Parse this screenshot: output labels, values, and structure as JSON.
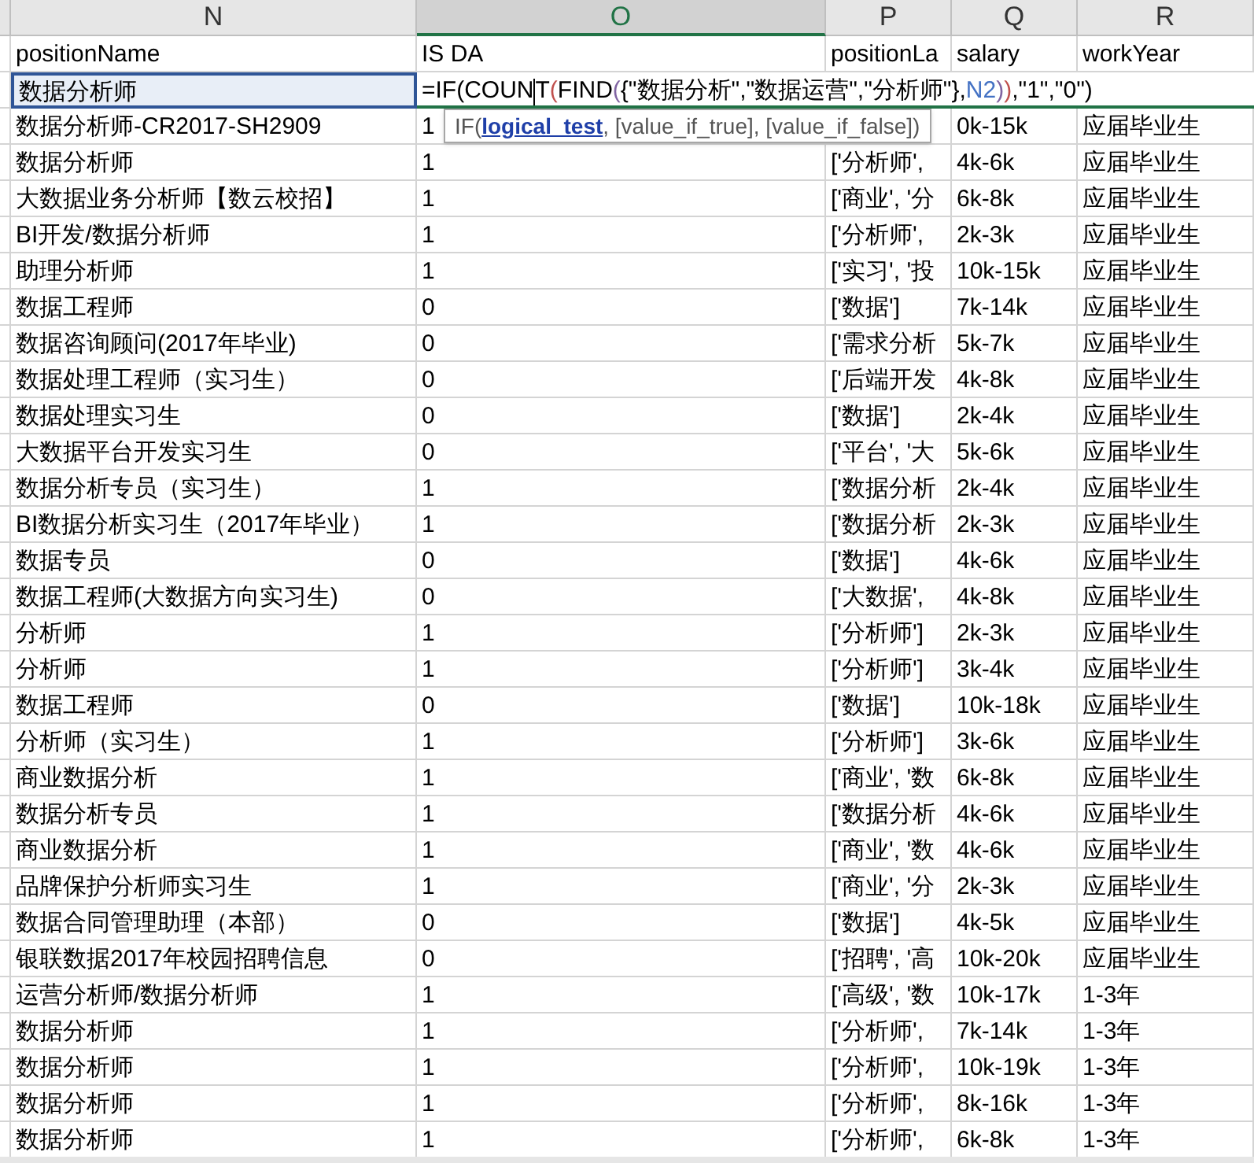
{
  "columns": [
    {
      "letter": "N",
      "selected": false
    },
    {
      "letter": "O",
      "selected": true
    },
    {
      "letter": "P",
      "selected": false
    },
    {
      "letter": "Q",
      "selected": false
    },
    {
      "letter": "R",
      "selected": false
    }
  ],
  "header_row": [
    "positionName",
    "IS DA",
    "positionLa",
    "salary",
    "workYear"
  ],
  "editing_row": {
    "name": "数据分析师",
    "selected": true,
    "formula": [
      {
        "text": "=IF(COUN",
        "color": "#000000"
      },
      {
        "text": "T",
        "color": "#000000"
      },
      {
        "text": "(",
        "color": "#c0504d"
      },
      {
        "text": "FIND",
        "color": "#000000"
      },
      {
        "text": "(",
        "color": "#8064a2"
      },
      {
        "text": "{\"数据分析\",\"数据运营\",\"分析师\"}",
        "color": "#000000"
      },
      {
        "text": ",",
        "color": "#000000"
      },
      {
        "text": "N2",
        "color": "#4472c4"
      },
      {
        "text": ")",
        "color": "#8064a2"
      },
      {
        "text": ")",
        "color": "#c0504d"
      },
      {
        "text": ",\"1\",\"0\")",
        "color": "#000000"
      }
    ]
  },
  "tooltip": {
    "prefix": "IF(",
    "argument": "logical_test",
    "suffix": ", [value_if_true], [value_if_false])"
  },
  "rows": [
    {
      "name": "数据分析师-CR2017-SH2909",
      "flag": "1",
      "salary": "0k-15k",
      "years": "应届毕业生"
    },
    {
      "name": "数据分析师",
      "flag": "1",
      "tags": "['分析师',",
      "salary": "4k-6k",
      "years": "应届毕业生"
    },
    {
      "name": "大数据业务分析师【数云校招】",
      "flag": "1",
      "tags": "['商业', '分",
      "salary": "6k-8k",
      "years": "应届毕业生"
    },
    {
      "name": "BI开发/数据分析师",
      "flag": "1",
      "tags": "['分析师',",
      "salary": "2k-3k",
      "years": "应届毕业生"
    },
    {
      "name": "助理分析师",
      "flag": "1",
      "tags": "['实习', '投",
      "salary": "10k-15k",
      "years": "应届毕业生"
    },
    {
      "name": "数据工程师",
      "flag": "0",
      "tags": "['数据']",
      "salary": "7k-14k",
      "years": "应届毕业生"
    },
    {
      "name": "数据咨询顾问(2017年毕业)",
      "flag": "0",
      "tags": "['需求分析",
      "salary": "5k-7k",
      "years": "应届毕业生"
    },
    {
      "name": "数据处理工程师（实习生）",
      "flag": "0",
      "tags": "['后端开发",
      "salary": "4k-8k",
      "years": "应届毕业生"
    },
    {
      "name": "数据处理实习生",
      "flag": "0",
      "tags": "['数据']",
      "salary": "2k-4k",
      "years": "应届毕业生"
    },
    {
      "name": "大数据平台开发实习生",
      "flag": "0",
      "tags": "['平台', '大",
      "salary": "5k-6k",
      "years": "应届毕业生"
    },
    {
      "name": "数据分析专员（实习生）",
      "flag": "1",
      "tags": "['数据分析",
      "salary": "2k-4k",
      "years": "应届毕业生"
    },
    {
      "name": "BI数据分析实习生（2017年毕业）",
      "flag": "1",
      "tags": "['数据分析",
      "salary": "2k-3k",
      "years": "应届毕业生"
    },
    {
      "name": "数据专员",
      "flag": "0",
      "tags": "['数据']",
      "salary": "4k-6k",
      "years": "应届毕业生"
    },
    {
      "name": "数据工程师(大数据方向实习生)",
      "flag": "0",
      "tags": "['大数据',",
      "salary": "4k-8k",
      "years": "应届毕业生"
    },
    {
      "name": "分析师",
      "flag": "1",
      "tags": "['分析师']",
      "salary": "2k-3k",
      "years": "应届毕业生"
    },
    {
      "name": "分析师",
      "flag": "1",
      "tags": "['分析师']",
      "salary": "3k-4k",
      "years": "应届毕业生"
    },
    {
      "name": "数据工程师",
      "flag": "0",
      "tags": "['数据']",
      "salary": "10k-18k",
      "years": "应届毕业生"
    },
    {
      "name": "分析师（实习生）",
      "flag": "1",
      "tags": "['分析师']",
      "salary": "3k-6k",
      "years": "应届毕业生"
    },
    {
      "name": "商业数据分析",
      "flag": "1",
      "tags": "['商业', '数",
      "salary": "6k-8k",
      "years": "应届毕业生"
    },
    {
      "name": "数据分析专员",
      "flag": "1",
      "tags": "['数据分析",
      "salary": "4k-6k",
      "years": "应届毕业生"
    },
    {
      "name": "商业数据分析",
      "flag": "1",
      "tags": "['商业', '数",
      "salary": "4k-6k",
      "years": "应届毕业生"
    },
    {
      "name": "品牌保护分析师实习生",
      "flag": "1",
      "tags": "['商业', '分",
      "salary": "2k-3k",
      "years": "应届毕业生"
    },
    {
      "name": "数据合同管理助理（本部）",
      "flag": "0",
      "tags": "['数据']",
      "salary": "4k-5k",
      "years": "应届毕业生"
    },
    {
      "name": "银联数据2017年校园招聘信息",
      "flag": "0",
      "tags": "['招聘', '高",
      "salary": "10k-20k",
      "years": "应届毕业生"
    },
    {
      "name": "运营分析师/数据分析师",
      "flag": "1",
      "tags": "['高级', '数",
      "salary": "10k-17k",
      "years": "1-3年"
    },
    {
      "name": "数据分析师",
      "flag": "1",
      "tags": "['分析师',",
      "salary": "7k-14k",
      "years": "1-3年"
    },
    {
      "name": "数据分析师",
      "flag": "1",
      "tags": "['分析师',",
      "salary": "10k-19k",
      "years": "1-3年"
    },
    {
      "name": "数据分析师",
      "flag": "1",
      "tags": "['分析师',",
      "salary": "8k-16k",
      "years": "1-3年"
    },
    {
      "name": "数据分析师",
      "flag": "1",
      "tags": "['分析师',",
      "salary": "6k-8k",
      "years": "1-3年"
    }
  ]
}
